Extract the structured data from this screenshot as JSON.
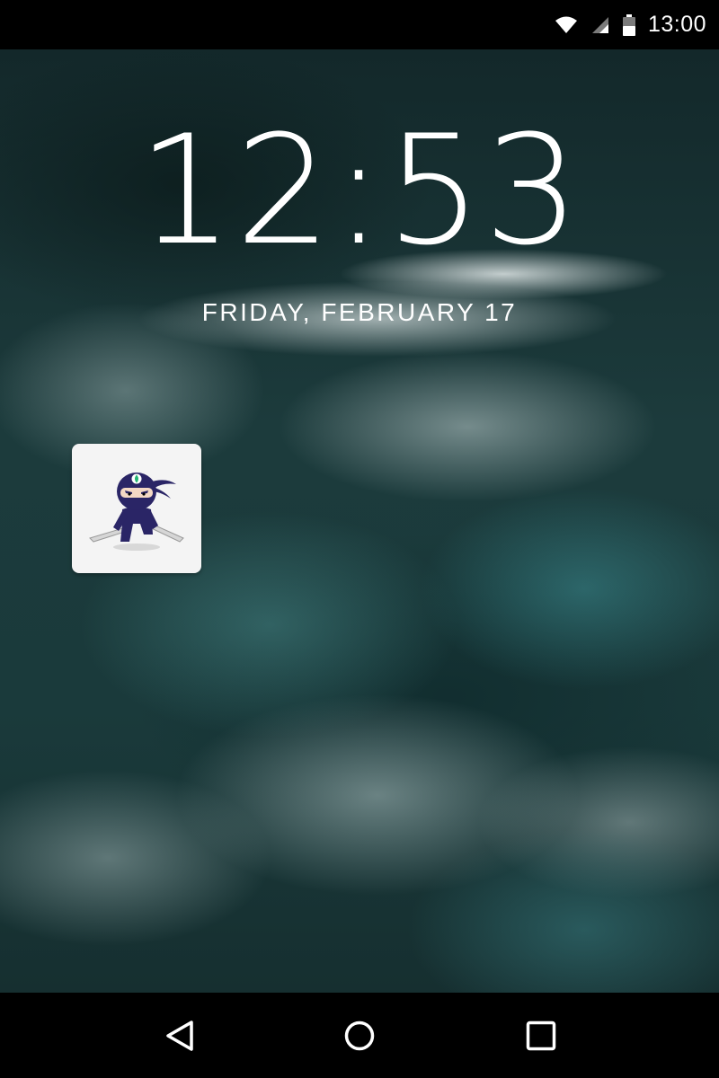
{
  "status_bar": {
    "time": "13:00",
    "icons": [
      "wifi-icon",
      "cell-signal-icon",
      "battery-icon"
    ]
  },
  "lock_screen": {
    "clock": "12:53",
    "date": "FRIDAY, FEBRUARY 17"
  },
  "shortcut": {
    "icon": "ninja-app-icon"
  },
  "nav_bar": {
    "buttons": [
      "back-icon",
      "home-icon",
      "recents-icon"
    ]
  },
  "colors": {
    "bar_background": "#000000",
    "text": "#ffffff",
    "ninja_primary": "#2a2566",
    "ninja_leaf": "#23b573"
  }
}
